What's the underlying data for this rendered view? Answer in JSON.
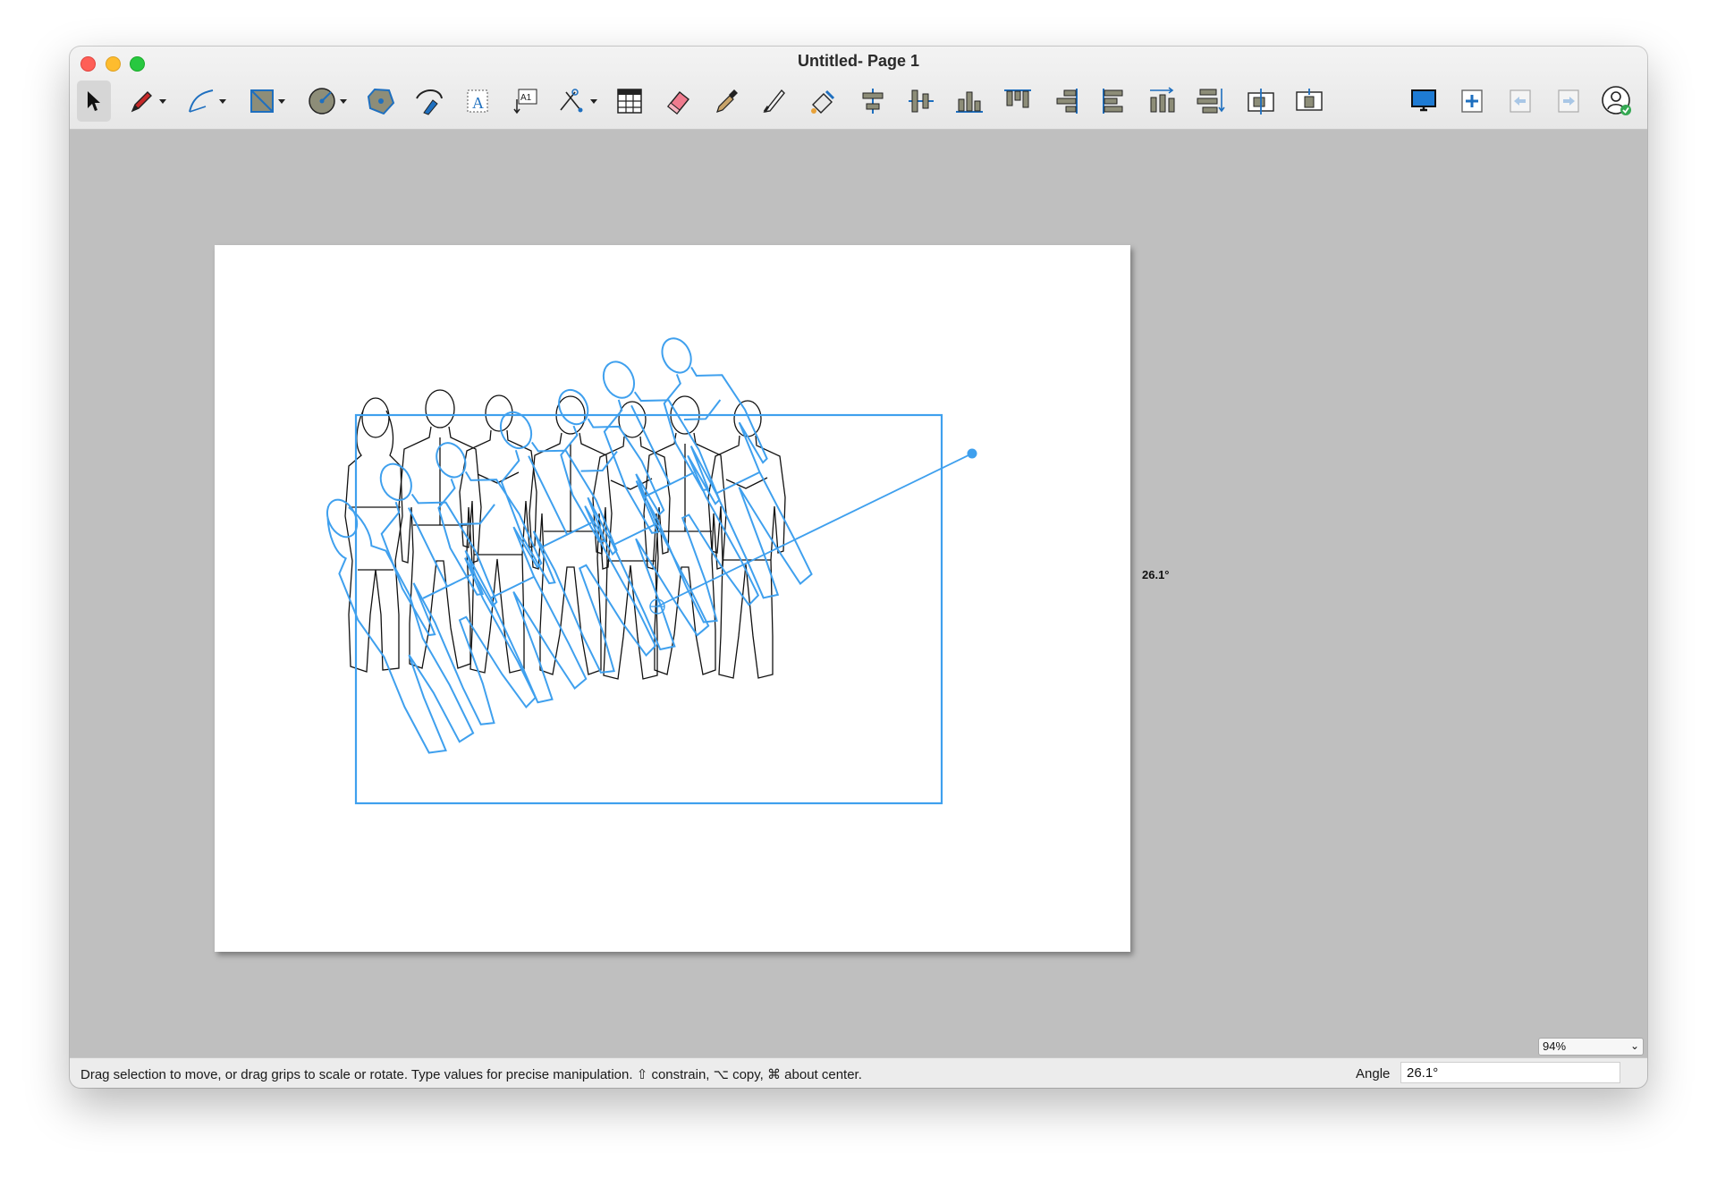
{
  "window": {
    "title": "Untitled- Page 1"
  },
  "toolbar": {
    "tools": [
      {
        "name": "selection-tool",
        "icon": "arrow-cursor-icon",
        "selected": true
      },
      {
        "name": "pencil-tool",
        "icon": "pencil-icon"
      },
      {
        "name": "curve-tool",
        "icon": "bezier-curve-icon"
      },
      {
        "name": "rectangle-tool",
        "icon": "rectangle-shape-icon"
      },
      {
        "name": "circle-tool",
        "icon": "circle-shape-icon"
      },
      {
        "name": "polygon-tool",
        "icon": "polygon-shape-icon"
      },
      {
        "name": "freehand-tool",
        "icon": "pen-stroke-icon"
      },
      {
        "name": "text-tool",
        "icon": "text-box-icon"
      },
      {
        "name": "text-on-path-tool",
        "icon": "text-label-icon"
      },
      {
        "name": "dimension-tool",
        "icon": "measure-icon"
      },
      {
        "name": "table-tool",
        "icon": "table-icon"
      },
      {
        "name": "eraser-tool",
        "icon": "eraser-icon"
      },
      {
        "name": "eyedropper-tool",
        "icon": "eyedropper-icon"
      },
      {
        "name": "knife-tool",
        "icon": "knife-icon"
      },
      {
        "name": "fill-tool",
        "icon": "paint-bucket-icon"
      },
      {
        "name": "align-center-horizontal",
        "icon": "align-center-horizontal-icon"
      },
      {
        "name": "align-center-vertical",
        "icon": "align-center-vertical-icon"
      },
      {
        "name": "align-bottom",
        "icon": "align-bottom-icon"
      },
      {
        "name": "align-top",
        "icon": "align-top-icon"
      },
      {
        "name": "align-right",
        "icon": "align-right-icon"
      },
      {
        "name": "align-left",
        "icon": "align-left-icon"
      },
      {
        "name": "distribute-horizontal",
        "icon": "distribute-horizontal-icon"
      },
      {
        "name": "distribute-vertical",
        "icon": "distribute-vertical-icon"
      },
      {
        "name": "center-on-page-horizontal",
        "icon": "center-page-horizontal-icon"
      },
      {
        "name": "center-on-page-vertical",
        "icon": "center-page-vertical-icon"
      },
      {
        "name": "presentation-mode",
        "icon": "monitor-icon"
      },
      {
        "name": "add-page",
        "icon": "add-page-icon"
      },
      {
        "name": "previous-page",
        "icon": "previous-page-icon"
      },
      {
        "name": "next-page",
        "icon": "next-page-icon"
      },
      {
        "name": "account",
        "icon": "user-account-icon"
      }
    ],
    "accent_color": "#1e88d8"
  },
  "canvas": {
    "selection_color": "#3fa0ee",
    "rotation_angle_label": "26.1°",
    "drawing": "line-art-group-of-people"
  },
  "zoom": {
    "value": "94%"
  },
  "status": {
    "hint": "Drag selection to move, or drag grips to scale or rotate. Type values for precise manipulation. ⇧ constrain, ⌥ copy, ⌘ about center.",
    "angle_label": "Angle",
    "angle_value": "26.1°"
  }
}
